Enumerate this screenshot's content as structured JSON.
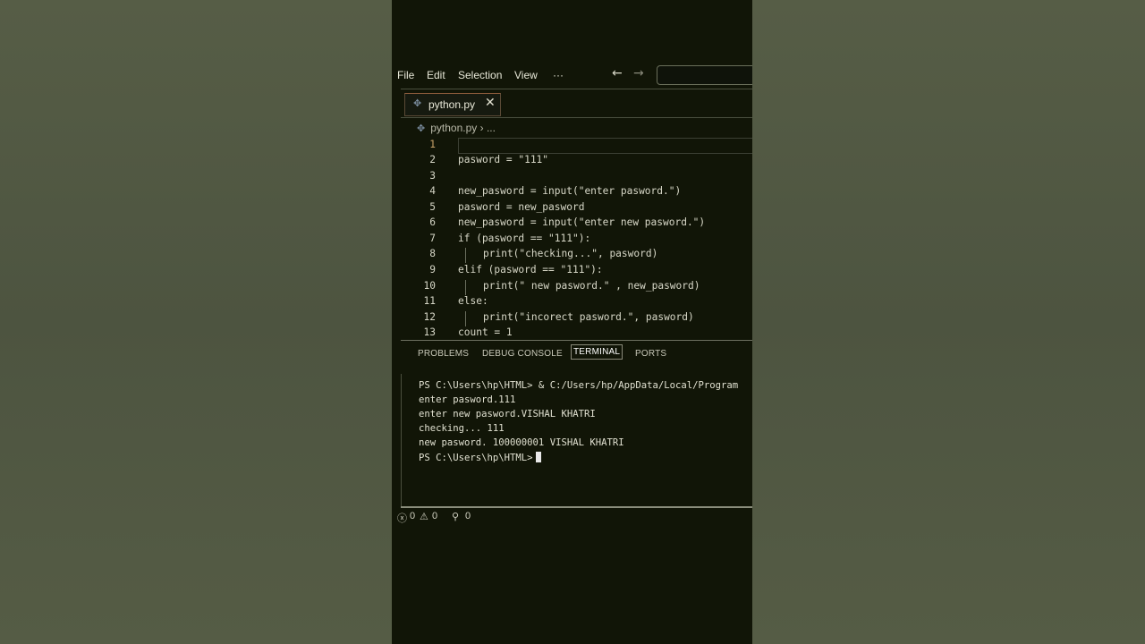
{
  "menu": {
    "items": [
      "File",
      "Edit",
      "Selection",
      "View"
    ],
    "more": "···",
    "back_icon": "←",
    "forward_icon": "→"
  },
  "tab": {
    "label": "python.py",
    "close": "✕"
  },
  "breadcrumb": {
    "file": "python.py",
    "separator": "›",
    "rest": "..."
  },
  "editor": {
    "lines": [
      {
        "num": "1",
        "text": ""
      },
      {
        "num": "2",
        "text": "pasword = \"111\""
      },
      {
        "num": "3",
        "text": ""
      },
      {
        "num": "4",
        "text": "new_pasword = input(\"enter pasword.\")"
      },
      {
        "num": "5",
        "text": "pasword = new_pasword"
      },
      {
        "num": "6",
        "text": "new_pasword = input(\"enter new pasword.\")"
      },
      {
        "num": "7",
        "text": "if (pasword == \"111\"):"
      },
      {
        "num": "8",
        "text": "print(\"checking...\", pasword)"
      },
      {
        "num": "9",
        "text": "elif (pasword == \"111\"):"
      },
      {
        "num": "10",
        "text": "print(\" new pasword.\" , new_pasword)"
      },
      {
        "num": "11",
        "text": "else:"
      },
      {
        "num": "12",
        "text": "print(\"incorect pasword.\", pasword)"
      },
      {
        "num": "13",
        "text": "count = 1"
      }
    ]
  },
  "panel": {
    "tabs": [
      "PROBLEMS",
      "DEBUG CONSOLE",
      "TERMINAL",
      "PORTS"
    ],
    "active_tab": "TERMINAL"
  },
  "terminal": {
    "lines": [
      "PS C:\\Users\\hp\\HTML> & C:/Users/hp/AppData/Local/Program",
      "enter pasword.111",
      "enter new pasword.VISHAL KHATRI",
      "checking... 111",
      "new pasword. 100000001 VISHAL KHATRI",
      "PS C:\\Users\\hp\\HTML>"
    ]
  },
  "status": {
    "errors": "0",
    "warnings": "0",
    "ports": "0"
  }
}
